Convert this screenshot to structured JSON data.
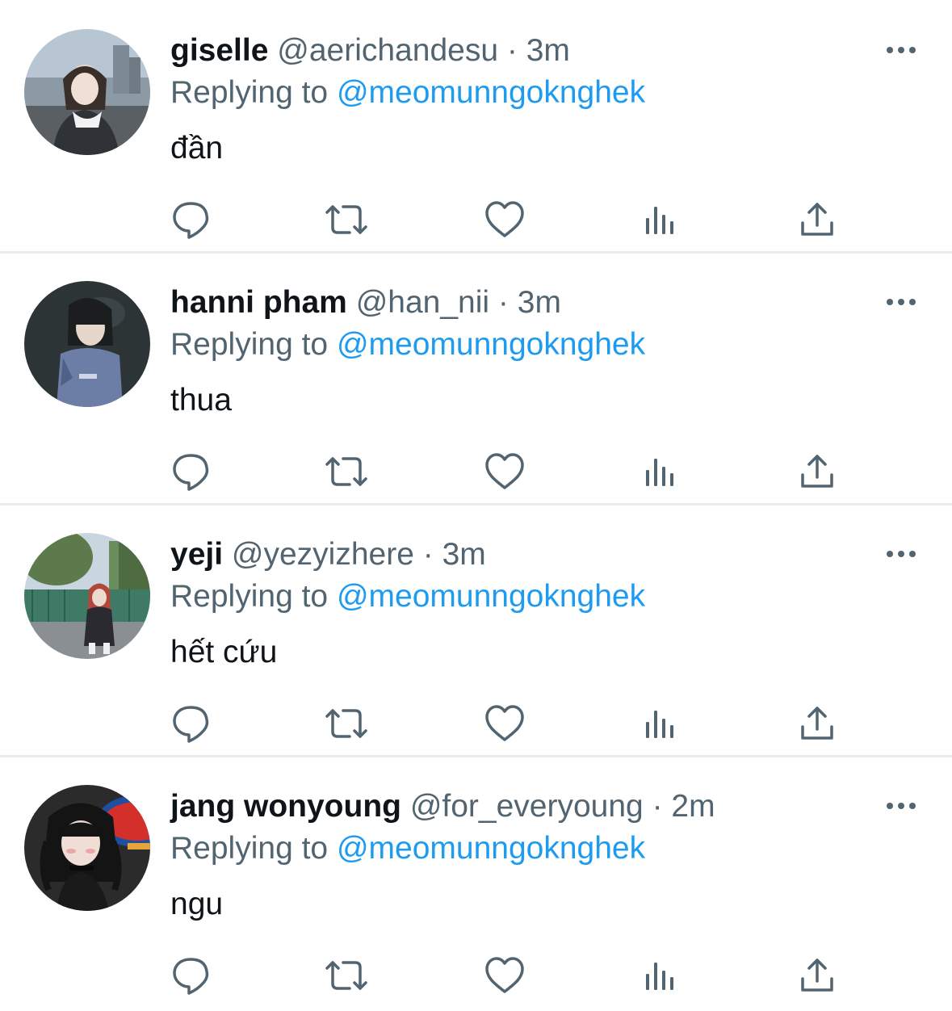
{
  "colors": {
    "text": "#0f1419",
    "muted": "#536471",
    "accent": "#1d9bf0",
    "divider": "#e9ecef"
  },
  "replying_prefix": "Replying to",
  "separator": "·",
  "tweets": [
    {
      "name": "giselle",
      "handle": "@aerichandesu",
      "time": "3m",
      "replying_to": "@meomunngoknghek",
      "text": "đần"
    },
    {
      "name": "hanni pham",
      "handle": "@han_nii",
      "time": "3m",
      "replying_to": "@meomunngoknghek",
      "text": "thua"
    },
    {
      "name": "yeji",
      "handle": "@yezyizhere",
      "time": "3m",
      "replying_to": "@meomunngoknghek",
      "text": "hết cứu"
    },
    {
      "name": "jang wonyoung",
      "handle": "@for_everyoung",
      "time": "2m",
      "replying_to": "@meomunngoknghek",
      "text": "ngu"
    }
  ],
  "icons": {
    "more": "more-horizontal-icon",
    "reply": "reply-icon",
    "retweet": "retweet-icon",
    "like": "heart-icon",
    "views": "views-chart-icon",
    "share": "share-icon"
  }
}
